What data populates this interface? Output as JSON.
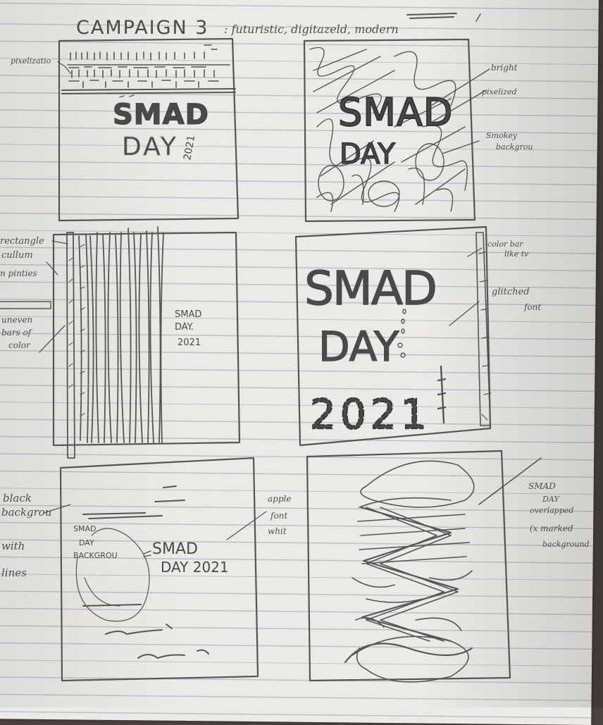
{
  "title": "CAMPAIGN 3",
  "subtitle": ": futuristic, digitazeld, modern",
  "sketch1": {
    "note_pixelized": "pixelizatio",
    "smad": "SMAD",
    "day": "DAY",
    "year": "2021"
  },
  "sketch2": {
    "smad": "SMAD",
    "day": "DAY",
    "note_bright": "bright",
    "note_pixelized": "pixelized",
    "note_smoky_1": "Smokey",
    "note_smoky_2": "backgrou"
  },
  "sketch3": {
    "note_left_1": "rectangle",
    "note_left_2": "cullum",
    "note_left_3": "n pinties",
    "note_bars_1": "uneven",
    "note_bars_2": "bars of",
    "note_bars_3": "color",
    "smad": "SMAD",
    "day": "DAY.",
    "year": "2021"
  },
  "sketch4": {
    "smad": "SMAD",
    "day": "DAY",
    "year": "2021",
    "note_colorbar_1": "color bar",
    "note_colorbar_2": "like tv",
    "note_glitch_1": "glitched",
    "note_glitch_2": "font"
  },
  "sketch5": {
    "note_black_1": "black",
    "note_black_2": "backgrou",
    "note_black_3": "with",
    "note_black_4": "lines",
    "faint_smad": "SMAD",
    "faint_day": "DAY",
    "faint_bg": "BACKGROU",
    "smad": "SMAD",
    "day_year": "DAY 2021",
    "note_font_1": "apple",
    "note_font_2": "font",
    "note_font_3": "whit"
  },
  "sketch6": {
    "note_1": "SMAD",
    "note_2": "DAY",
    "note_3": "overlapped",
    "note_4": "(x marked",
    "note_5": "background"
  }
}
